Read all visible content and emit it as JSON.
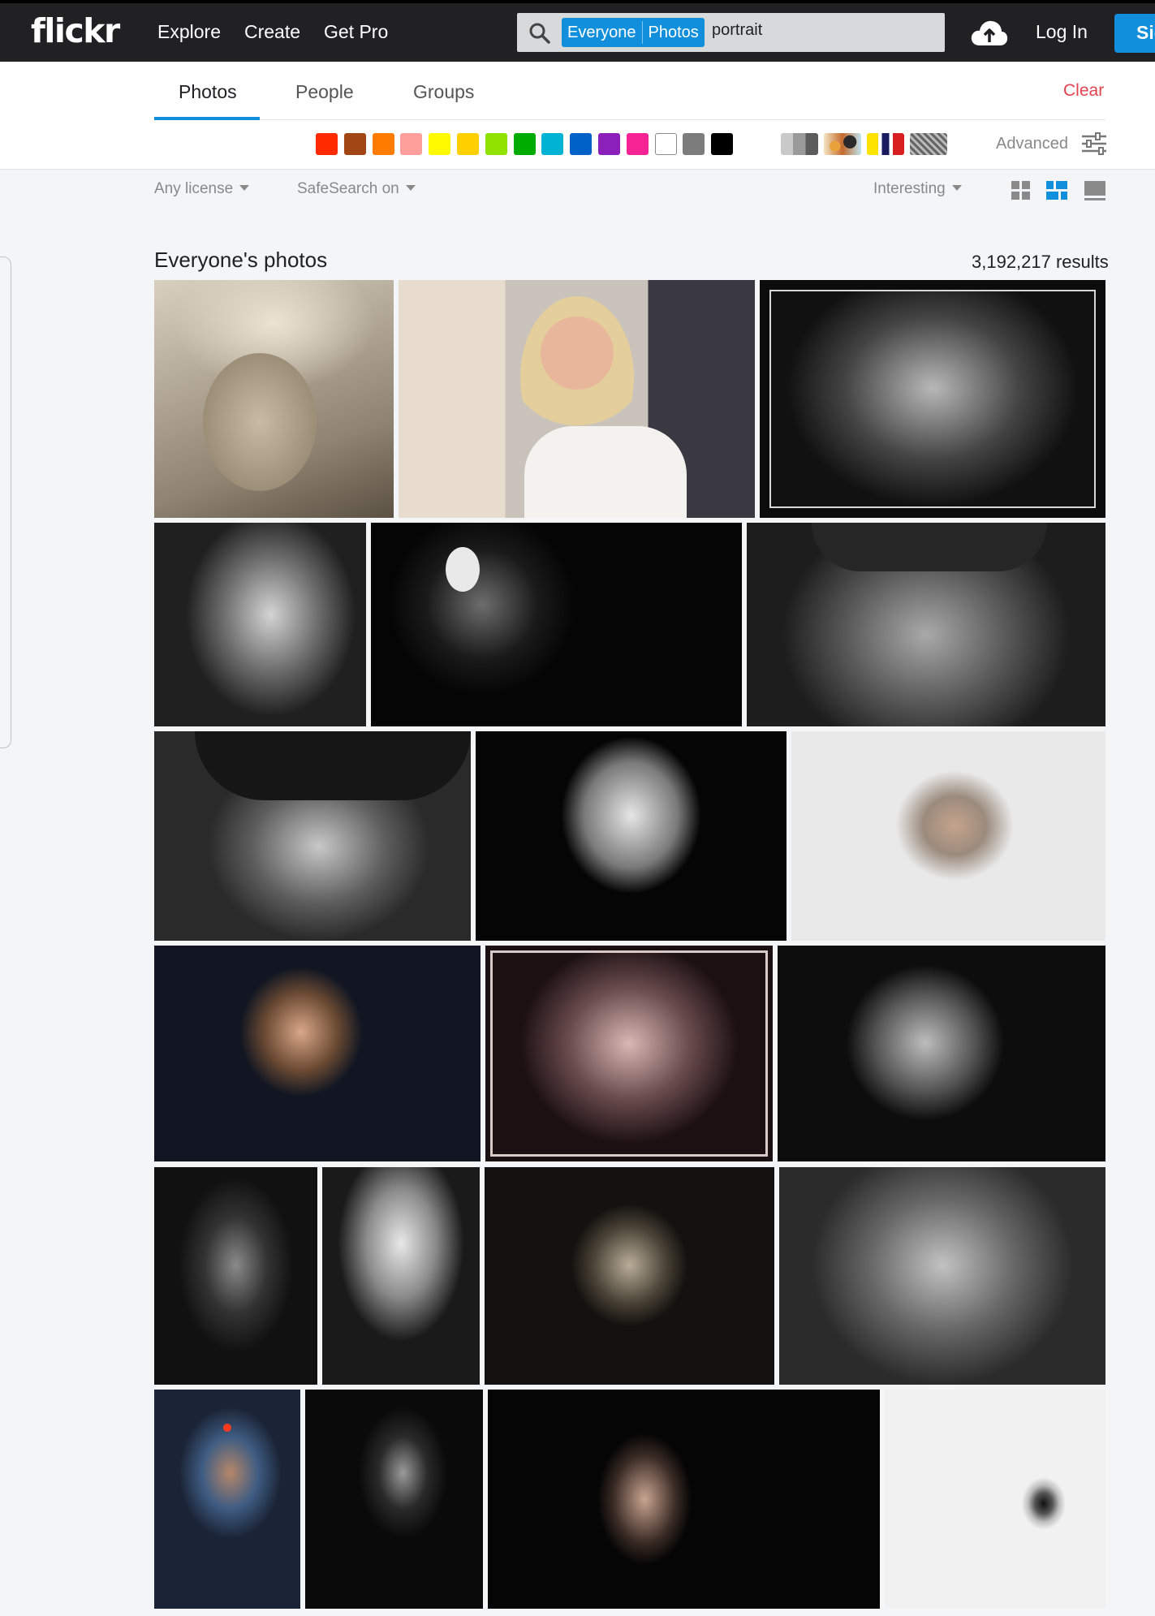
{
  "nav": {
    "logo": "flickr",
    "links": [
      "Explore",
      "Create",
      "Get Pro"
    ],
    "search": {
      "scope_primary": "Everyone",
      "scope_secondary": "Photos",
      "query": "portrait"
    },
    "upload_icon": "cloud-upload-icon",
    "login_label": "Log In",
    "signup_label": "Sign Up"
  },
  "tabs": {
    "items": [
      "Photos",
      "People",
      "Groups"
    ],
    "active": "Photos",
    "clear_label": "Clear"
  },
  "color_filters": [
    "#ff2a00",
    "#a24615",
    "#ff7c00",
    "#ff9f9c",
    "#fffa00",
    "#ffcf00",
    "#90e200",
    "#00ab00",
    "#00b2d4",
    "#0062c6",
    "#8c20ba",
    "#f52394",
    "#ffffff",
    "#7c7c7c",
    "#000000"
  ],
  "style_filters": [
    "black-and-white",
    "shallow-depth-of-field",
    "minimalism",
    "patterns"
  ],
  "advanced_label": "Advanced",
  "filters": {
    "license": "Any license",
    "safesearch": "SafeSearch on",
    "sort": "Interesting"
  },
  "view_modes": [
    "grid-small-icon",
    "justified-icon",
    "large-view-icon"
  ],
  "results": {
    "heading": "Everyone's photos",
    "count": "3,192,217 results"
  },
  "photos": [
    {
      "title": "child-in-knit-hat",
      "tone": "sepia"
    },
    {
      "title": "blonde-woman-white-shirt",
      "tone": "color"
    },
    {
      "title": "curly-haired-woman",
      "tone": "bw"
    },
    {
      "title": "woman-with-spiral-earrings",
      "tone": "bw"
    },
    {
      "title": "couple-embracing",
      "tone": "dark"
    },
    {
      "title": "old-man-in-beanie",
      "tone": "bw"
    },
    {
      "title": "man-in-fedora",
      "tone": "bw"
    },
    {
      "title": "woman-hand-on-chin",
      "tone": "dark"
    },
    {
      "title": "girl-windblown-hair",
      "tone": "light"
    },
    {
      "title": "woman-dark-background",
      "tone": "color"
    },
    {
      "title": "woman-in-chains",
      "tone": "pink"
    },
    {
      "title": "woman-half-lit-face",
      "tone": "bw"
    },
    {
      "title": "woman-behind-rain-glass",
      "tone": "dark"
    },
    {
      "title": "screaming-girl-glasses",
      "tone": "bw"
    },
    {
      "title": "old-woman-in-hat",
      "tone": "sepia"
    },
    {
      "title": "wrinkled-old-woman",
      "tone": "bw"
    },
    {
      "title": "woman-in-blue-shawl",
      "tone": "color"
    },
    {
      "title": "woman-in-shadow",
      "tone": "dark"
    },
    {
      "title": "virtual-blonde-figure",
      "tone": "dark"
    },
    {
      "title": "close-up-eye",
      "tone": "light"
    }
  ]
}
